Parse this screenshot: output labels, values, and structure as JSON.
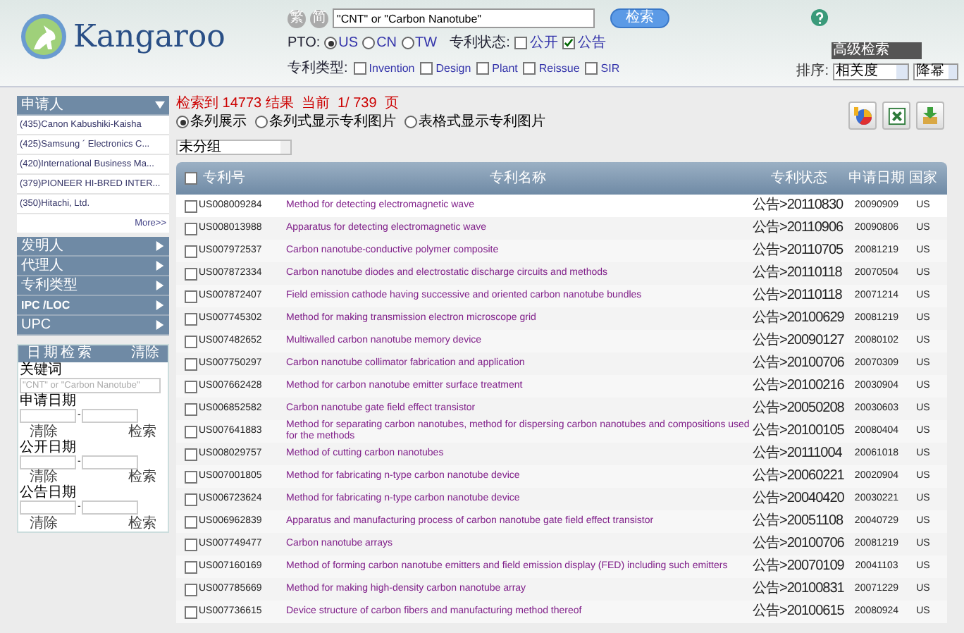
{
  "header": {
    "logo_text": "Kangaroo",
    "lang_buttons": [
      "繁",
      "简"
    ],
    "search_value": "\"CNT\" or \"Carbon Nanotube\"",
    "search_button": "检索",
    "pto_label": "PTO:",
    "pto_options": [
      {
        "label": "US",
        "selected": true
      },
      {
        "label": "CN",
        "selected": false
      },
      {
        "label": "TW",
        "selected": false
      }
    ],
    "status_label": "专利状态:",
    "status_options": [
      {
        "label": "公开",
        "checked": false
      },
      {
        "label": "公告",
        "checked": true
      }
    ],
    "type_label": "专利类型:",
    "type_options": [
      {
        "label": "Invention",
        "checked": false
      },
      {
        "label": "Design",
        "checked": false
      },
      {
        "label": "Plant",
        "checked": false
      },
      {
        "label": "Reissue",
        "checked": false
      },
      {
        "label": "SIR",
        "checked": false
      }
    ],
    "advanced": "高级检索",
    "sort_label": "排序:",
    "sort_value": "相关度",
    "order_value": "降幂"
  },
  "sidebar": {
    "panels": [
      {
        "title": "申请人",
        "expanded": true,
        "items": [
          "(435)Canon Kabushiki-Kaisha",
          "(425)Samsung ´ Electronics C...",
          "(420)International Business Ma...",
          "(379)PIONEER HI-BRED INTER...",
          "(350)Hitachi, Ltd."
        ],
        "more": "More>>"
      },
      {
        "title": "发明人",
        "expanded": false
      },
      {
        "title": "代理人",
        "expanded": false
      },
      {
        "title": "专利类型",
        "expanded": false
      },
      {
        "title": "IPC /LOC",
        "expanded": false
      },
      {
        "title": "UPC",
        "expanded": false
      }
    ],
    "date_search": {
      "title": "日期检索",
      "clear": "清除",
      "keyword_label": "关键词",
      "keyword_placeholder": "\"CNT\" or \"Carbon Nanotube\"",
      "groups": [
        {
          "label": "申请日期",
          "separator": "-",
          "clear": "清除",
          "search": "检索"
        },
        {
          "label": "公开日期",
          "separator": "-",
          "clear": "清除",
          "search": "检索"
        },
        {
          "label": "公告日期",
          "separator": "-",
          "clear": "清除",
          "search": "检索"
        }
      ]
    }
  },
  "results": {
    "summary": "检索到 14773 结果  当前  1/ 739  页",
    "view_options": [
      {
        "label": "条列展示",
        "selected": true
      },
      {
        "label": "条列式显示专利图片",
        "selected": false
      },
      {
        "label": "表格式显示专利图片",
        "selected": false
      }
    ],
    "group_select": "未分组",
    "header_checked": false,
    "columns": [
      "专利号",
      "专利名称",
      "专利状态",
      "申请日期",
      "国家"
    ],
    "rows": [
      {
        "number": "US008009284",
        "title": "Method for detecting electromagnetic wave",
        "status": "公告>20110830",
        "date": "20090909",
        "country": "US",
        "checked": false
      },
      {
        "number": "US008013988",
        "title": "Apparatus for detecting electromagnetic wave",
        "status": "公告>20110906",
        "date": "20090806",
        "country": "US",
        "checked": false
      },
      {
        "number": "US007972537",
        "title": "Carbon nanotube-conductive polymer composite",
        "status": "公告>20110705",
        "date": "20081219",
        "country": "US",
        "checked": false
      },
      {
        "number": "US007872334",
        "title": "Carbon nanotube diodes and electrostatic discharge circuits and methods",
        "status": "公告>20110118",
        "date": "20070504",
        "country": "US",
        "checked": false
      },
      {
        "number": "US007872407",
        "title": "Field emission cathode having successive and oriented carbon nanotube bundles",
        "status": "公告>20110118",
        "date": "20071214",
        "country": "US",
        "checked": false
      },
      {
        "number": "US007745302",
        "title": "Method for making transmission electron microscope grid",
        "status": "公告>20100629",
        "date": "20081219",
        "country": "US",
        "checked": false
      },
      {
        "number": "US007482652",
        "title": "Multiwalled carbon nanotube memory device",
        "status": "公告>20090127",
        "date": "20080102",
        "country": "US",
        "checked": false
      },
      {
        "number": "US007750297",
        "title": "Carbon nanotube collimator fabrication and application",
        "status": "公告>20100706",
        "date": "20070309",
        "country": "US",
        "checked": false
      },
      {
        "number": "US007662428",
        "title": "Method for carbon nanotube emitter surface treatment",
        "status": "公告>20100216",
        "date": "20030904",
        "country": "US",
        "checked": false
      },
      {
        "number": "US006852582",
        "title": "Carbon nanotube gate field effect transistor",
        "status": "公告>20050208",
        "date": "20030603",
        "country": "US",
        "checked": false
      },
      {
        "number": "US007641883",
        "title": "Method for separating carbon nanotubes, method for dispersing carbon nanotubes and compositions used for the methods",
        "status": "公告>20100105",
        "date": "20080404",
        "country": "US",
        "checked": false
      },
      {
        "number": "US008029757",
        "title": "Method of cutting carbon nanotubes",
        "status": "公告>20111004",
        "date": "20061018",
        "country": "US",
        "checked": false
      },
      {
        "number": "US007001805",
        "title": "Method for fabricating n-type carbon nanotube device",
        "status": "公告>20060221",
        "date": "20020904",
        "country": "US",
        "checked": false
      },
      {
        "number": "US006723624",
        "title": "Method for fabricating n-type carbon nanotube device",
        "status": "公告>20040420",
        "date": "20030221",
        "country": "US",
        "checked": false
      },
      {
        "number": "US006962839",
        "title": "Apparatus and manufacturing process of carbon nanotube gate field effect transistor",
        "status": "公告>20051108",
        "date": "20040729",
        "country": "US",
        "checked": false
      },
      {
        "number": "US007749477",
        "title": "Carbon nanotube arrays",
        "status": "公告>20100706",
        "date": "20081219",
        "country": "US",
        "checked": false
      },
      {
        "number": "US007160169",
        "title": "Method of forming carbon nanotube emitters and field emission display (FED) including such emitters",
        "status": "公告>20070109",
        "date": "20041103",
        "country": "US",
        "checked": false
      },
      {
        "number": "US007785669",
        "title": "Method for making high-density carbon nanotube array",
        "status": "公告>20100831",
        "date": "20071229",
        "country": "US",
        "checked": false
      },
      {
        "number": "US007736615",
        "title": "Device structure of carbon fibers and manufacturing method thereof",
        "status": "公告>20100615",
        "date": "20080924",
        "country": "US",
        "checked": false
      }
    ]
  }
}
